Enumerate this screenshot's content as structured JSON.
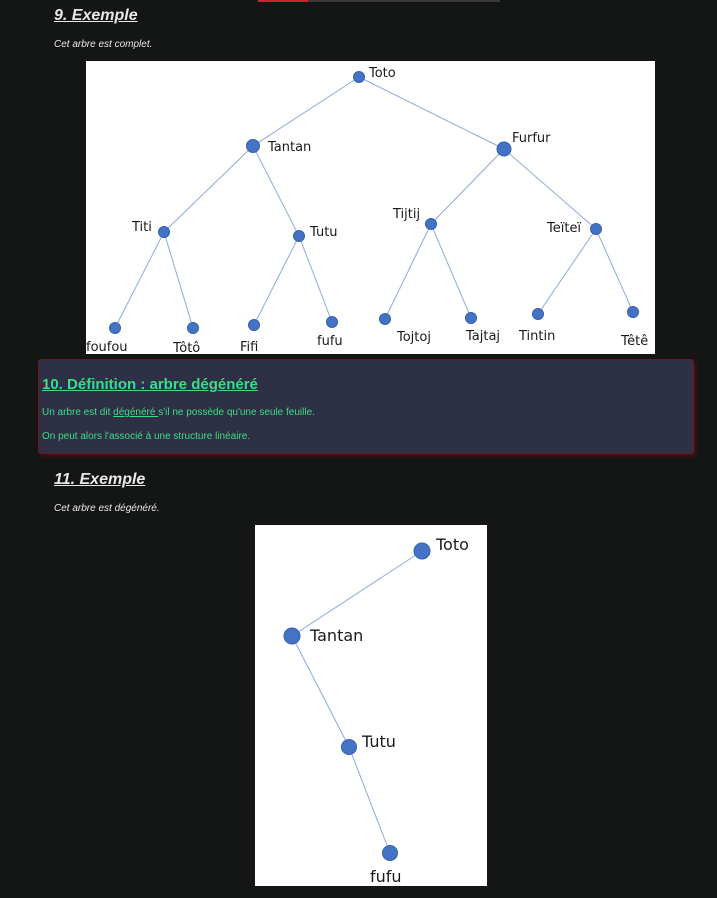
{
  "example9": {
    "title": "9. Exemple",
    "caption": "Cet arbre est complet."
  },
  "tree_complete": {
    "nodes": [
      {
        "id": "toto",
        "label": "Toto"
      },
      {
        "id": "tantan",
        "label": "Tantan"
      },
      {
        "id": "furfur",
        "label": "Furfur"
      },
      {
        "id": "titi",
        "label": "Titi"
      },
      {
        "id": "tutu",
        "label": "Tutu"
      },
      {
        "id": "tijtij",
        "label": "Tijtij"
      },
      {
        "id": "teitei",
        "label": "Teïteï"
      },
      {
        "id": "foufou",
        "label": "foufou"
      },
      {
        "id": "toto2",
        "label": "Tôtô"
      },
      {
        "id": "fifi",
        "label": "Fifi"
      },
      {
        "id": "fufu",
        "label": "fufu"
      },
      {
        "id": "tojtoj",
        "label": "Tojtoj"
      },
      {
        "id": "tajtaj",
        "label": "Tajtaj"
      },
      {
        "id": "tintin",
        "label": "Tintin"
      },
      {
        "id": "tete",
        "label": "Têtê"
      }
    ]
  },
  "definition10": {
    "title": "10. Définition : arbre dégénéré",
    "line1_before": "Un arbre est dit ",
    "line1_term": "dégénéré ",
    "line1_after": "s'il ne possède qu'une seule feuille.",
    "line2": "On peut alors l'associé à une structure linéaire."
  },
  "example11": {
    "title": "11. Exemple",
    "caption": "Cet arbre est dégénéré."
  },
  "tree_degenerate": {
    "nodes": [
      {
        "id": "toto",
        "label": "Toto"
      },
      {
        "id": "tantan",
        "label": "Tantan"
      },
      {
        "id": "tutu",
        "label": "Tutu"
      },
      {
        "id": "fufu",
        "label": "fufu"
      }
    ]
  }
}
